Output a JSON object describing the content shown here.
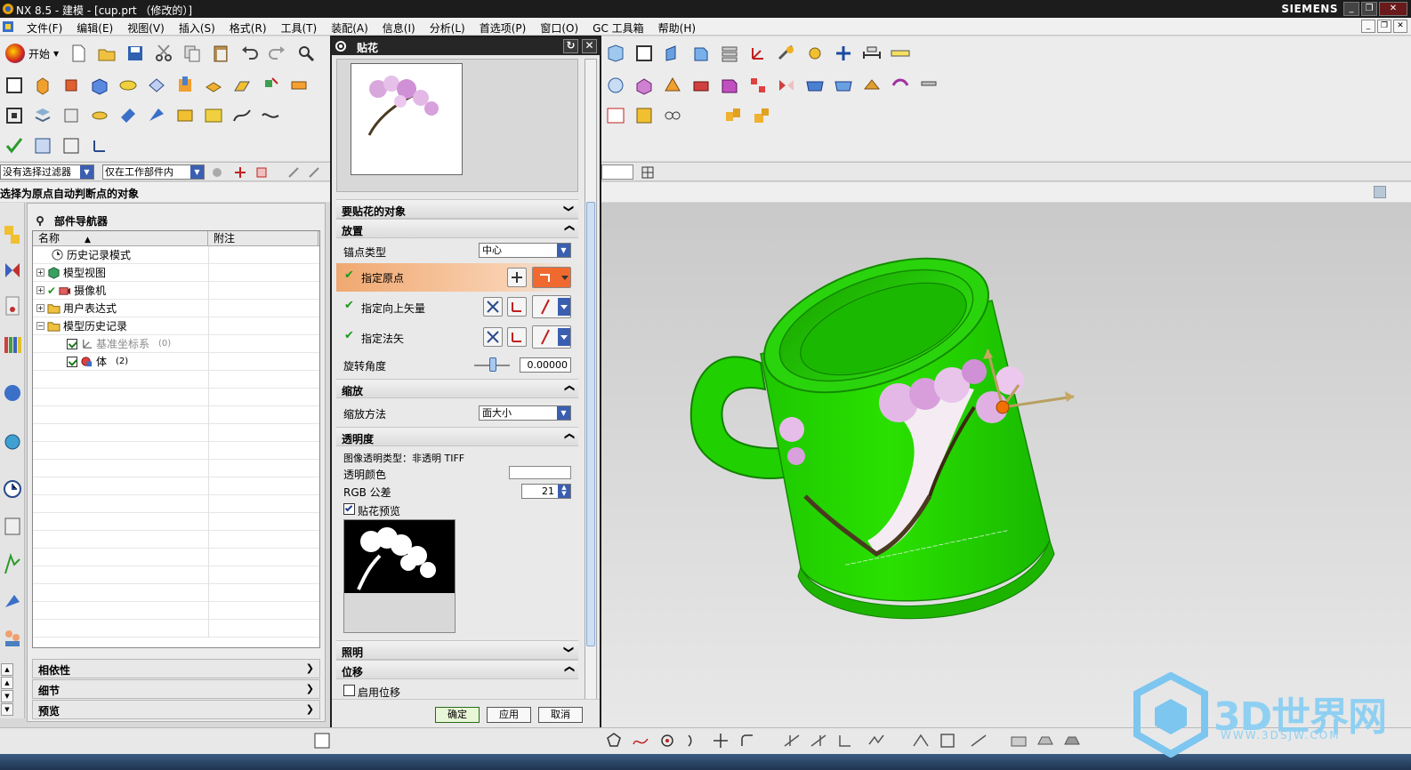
{
  "window": {
    "title": "NX 8.5 - 建模 - [cup.prt （修改的）]",
    "brand": "SIEMENS",
    "controls": [
      "_",
      "❐",
      "✕"
    ]
  },
  "menu": {
    "items": [
      "文件(F)",
      "编辑(E)",
      "视图(V)",
      "插入(S)",
      "格式(R)",
      "工具(T)",
      "装配(A)",
      "信息(I)",
      "分析(L)",
      "首选项(P)",
      "窗口(O)",
      "GC 工具箱",
      "帮助(H)"
    ]
  },
  "toolbar": {
    "start_label": "开始"
  },
  "filter": {
    "selection_filter": "没有选择过滤器",
    "scope": "仅在工作部件内"
  },
  "cue": {
    "text": "选择为原点自动判断点的对象"
  },
  "navigator": {
    "title": "部件导航器",
    "col_name": "名称",
    "col_note": "附注",
    "rows": [
      {
        "label": "历史记录模式"
      },
      {
        "label": "模型视图"
      },
      {
        "label": "摄像机"
      },
      {
        "label": "用户表达式"
      },
      {
        "label": "模型历史记录"
      },
      {
        "label": "基准坐标系",
        "suffix": "(0)"
      },
      {
        "label": "体",
        "suffix": "(2)"
      }
    ],
    "panels": [
      "相依性",
      "细节",
      "预览"
    ]
  },
  "dialog": {
    "title": "贴花",
    "sections": {
      "target": "要贴花的对象",
      "placement": "放置",
      "scale": "缩放",
      "transparency": "透明度",
      "lighting": "照明",
      "offset": "位移"
    },
    "anchor_type_label": "锚点类型",
    "anchor_type_value": "中心",
    "specify_origin": "指定原点",
    "specify_up_vector": "指定向上矢量",
    "specify_normal": "指定法矢",
    "rotation_label": "旋转角度",
    "rotation_value": "0.00000",
    "scale_method_label": "缩放方法",
    "scale_method_value": "面大小",
    "image_type_text": "图像透明类型：非透明 TIFF",
    "transparent_color_label": "透明颜色",
    "rgb_tolerance_label": "RGB 公差",
    "rgb_tolerance_value": "21",
    "decal_preview_label": "贴花预览",
    "enable_offset_label": "启用位移",
    "ok": "确定",
    "apply": "应用",
    "cancel": "取消"
  },
  "watermark": {
    "text": "3D世界网",
    "url": "WWW.3DSJW.COM"
  },
  "colors": {
    "cup_green": "#22dd00",
    "title_bg": "#1c1c1c",
    "highlight_orange": "#f0b078"
  }
}
